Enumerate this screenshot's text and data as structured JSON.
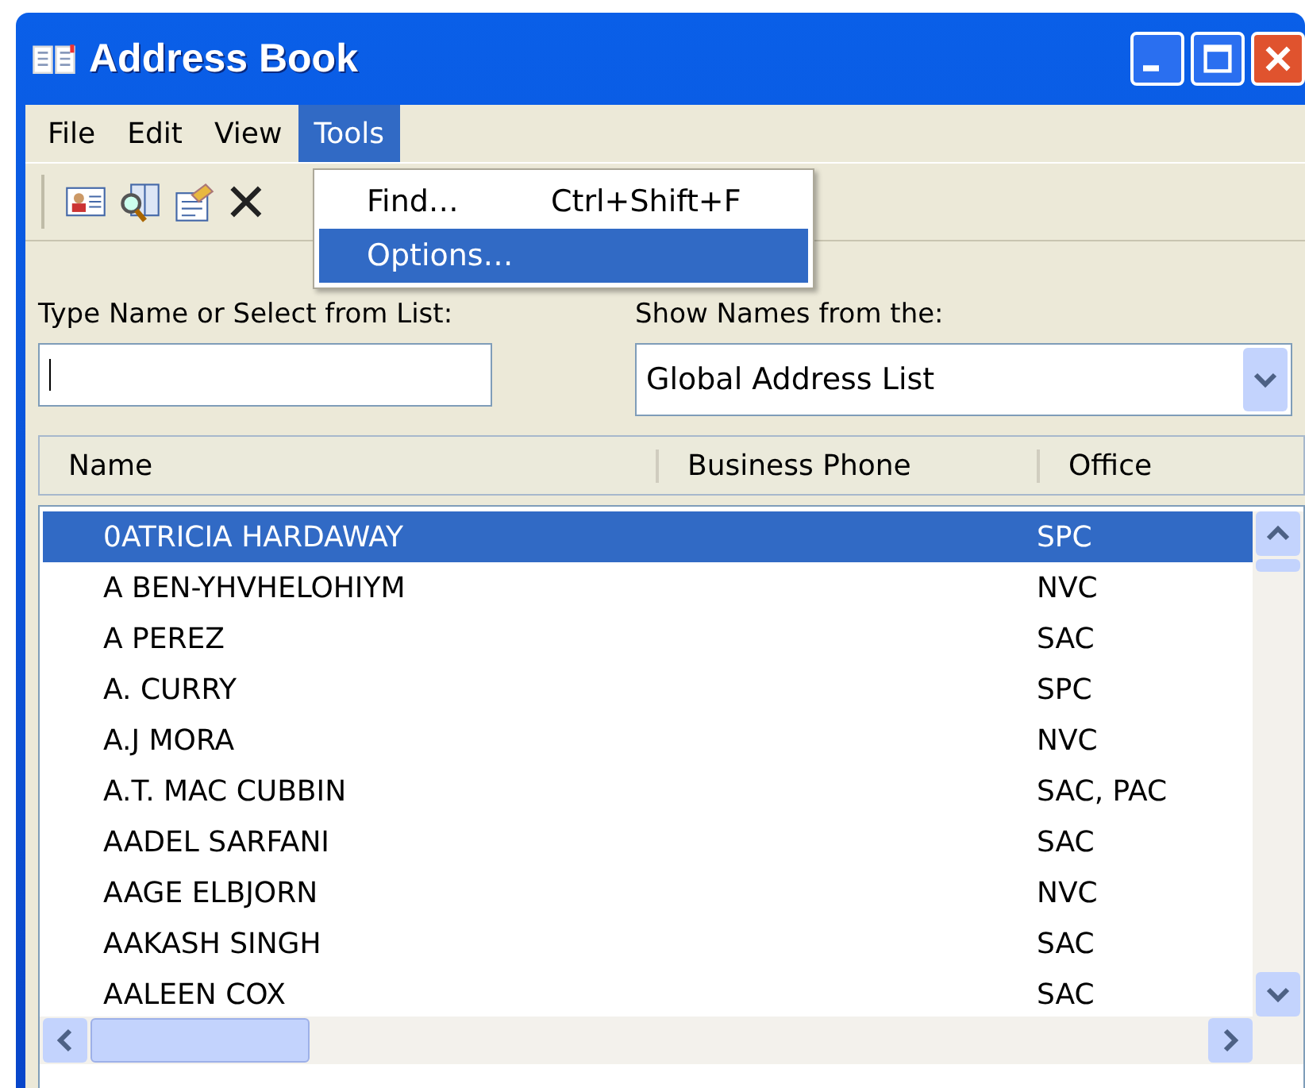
{
  "window": {
    "title": "Address Book"
  },
  "menu_bar": [
    {
      "label": "File",
      "selected": false
    },
    {
      "label": "Edit",
      "selected": false
    },
    {
      "label": "View",
      "selected": false
    },
    {
      "label": "Tools",
      "selected": true
    }
  ],
  "tools_menu": [
    {
      "label": "Find…",
      "shortcut": "Ctrl+Shift+F",
      "selected": false
    },
    {
      "label": "Options…",
      "selected": true
    }
  ],
  "search": {
    "label": "Type Name or Select from List:"
  },
  "address_list": {
    "label": "Show Names from the:",
    "value": "Global Address List"
  },
  "table": {
    "columns": [
      "Name",
      "Business Phone",
      "Office"
    ],
    "rows": [
      {
        "name": "0ATRICIA HARDAWAY",
        "office": "SPC",
        "selected": true
      },
      {
        "name": "A BEN-YHVHELOHIYM",
        "office": "NVC",
        "selected": false
      },
      {
        "name": "A PEREZ",
        "office": "SAC",
        "selected": false
      },
      {
        "name": "A. CURRY",
        "office": "SPC",
        "selected": false
      },
      {
        "name": "A.J MORA",
        "office": "NVC",
        "selected": false
      },
      {
        "name": "A.T. MAC CUBBIN",
        "office": "SAC, PAC",
        "selected": false
      },
      {
        "name": "AADEL SARFANI",
        "office": "SAC",
        "selected": false
      },
      {
        "name": "AAGE ELBJORN",
        "office": "NVC",
        "selected": false
      },
      {
        "name": "AAKASH SINGH",
        "office": "SAC",
        "selected": false
      },
      {
        "name": "AALEEN COX",
        "office": "SAC",
        "selected": false
      }
    ]
  }
}
